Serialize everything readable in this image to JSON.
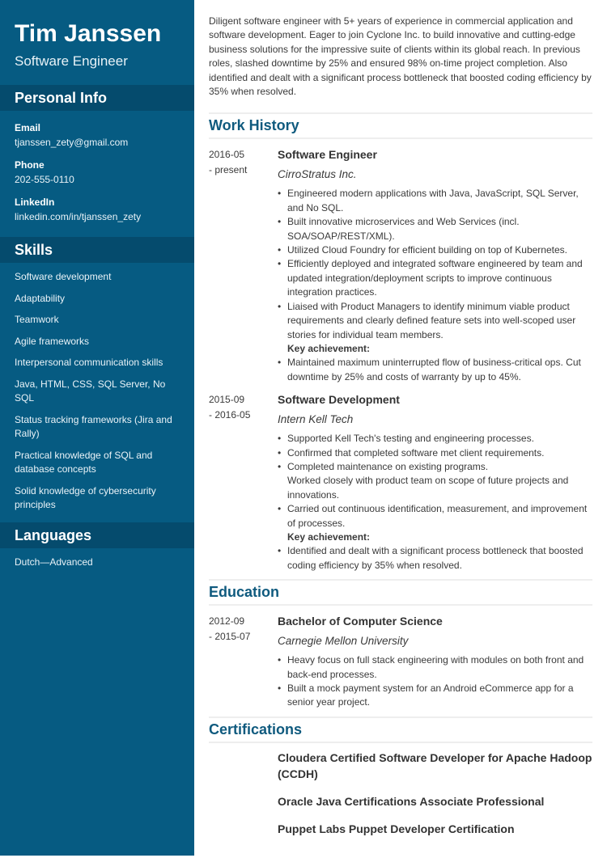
{
  "sidebar": {
    "name": "Tim Janssen",
    "role": "Software Engineer",
    "personal_info": {
      "heading": "Personal Info",
      "fields": [
        {
          "label": "Email",
          "value": "tjanssen_zety@gmail.com"
        },
        {
          "label": "Phone",
          "value": "202-555-0110"
        },
        {
          "label": "LinkedIn",
          "value": "linkedin.com/in/tjanssen_zety"
        }
      ]
    },
    "skills": {
      "heading": "Skills",
      "items": [
        "Software development",
        "Adaptability",
        "Teamwork",
        "Agile frameworks",
        "Interpersonal communication skills",
        "Java, HTML, CSS, SQL Server, No SQL",
        "Status tracking frameworks (Jira and Rally)",
        "Practical knowledge of SQL and database concepts",
        "Solid knowledge of cybersecurity principles"
      ]
    },
    "languages": {
      "heading": "Languages",
      "items": [
        "Dutch—Advanced"
      ]
    }
  },
  "main": {
    "summary": "Diligent software engineer with 5+ years of experience in commercial application and software development. Eager to join Cyclone Inc. to build innovative and cutting-edge business solutions for the impressive suite of clients within its global reach. In previous roles, slashed downtime by 25% and ensured 98% on-time project completion. Also identified and dealt with a significant process bottleneck that boosted coding efficiency by 35% when resolved.",
    "work_history": {
      "heading": "Work History",
      "entries": [
        {
          "date_start": "2016-05",
          "date_end": "- present",
          "title": "Software Engineer",
          "org": "CirroStratus Inc.",
          "bullets": [
            {
              "type": "b",
              "text": "Engineered modern applications with Java, JavaScript, SQL Server, and No SQL."
            },
            {
              "type": "b",
              "text": "Built innovative microservices and Web Services (incl. SOA/SOAP/REST/XML)."
            },
            {
              "type": "b",
              "text": "Utilized Cloud Foundry for efficient building on top of Kubernetes."
            },
            {
              "type": "b",
              "text": "Efficiently deployed and integrated software engineered by team and updated integration/deployment scripts to improve continuous integration practices."
            },
            {
              "type": "b",
              "text": "Liaised with Product Managers to identify minimum viable product requirements and clearly defined feature sets into well-scoped user stories for individual team members."
            },
            {
              "type": "key",
              "text": "Key achievement:"
            },
            {
              "type": "b",
              "text": "Maintained maximum uninterrupted flow of business-critical ops. Cut downtime by 25% and costs of warranty by up to 45%."
            }
          ]
        },
        {
          "date_start": "2015-09",
          "date_end": "- 2016-05",
          "title": "Software Development",
          "org": "Intern Kell Tech",
          "bullets": [
            {
              "type": "b",
              "text": "Supported Kell Tech's testing and engineering processes."
            },
            {
              "type": "b",
              "text": "Confirmed that completed software met client requirements."
            },
            {
              "type": "b",
              "text": "Completed maintenance on existing programs."
            },
            {
              "type": "plain",
              "text": "Worked closely with product team on scope of future projects and innovations."
            },
            {
              "type": "b",
              "text": "Carried out continuous identification, measurement, and improvement of processes."
            },
            {
              "type": "key",
              "text": "Key achievement:"
            },
            {
              "type": "b",
              "text": "Identified and dealt with a significant process bottleneck that boosted coding efficiency by 35% when resolved."
            }
          ]
        }
      ]
    },
    "education": {
      "heading": "Education",
      "entries": [
        {
          "date_start": "2012-09",
          "date_end": "- 2015-07",
          "title": "Bachelor of Computer Science",
          "org": "Carnegie Mellon University",
          "bullets": [
            {
              "type": "b",
              "text": "Heavy focus on full stack engineering with modules on both front and back-end processes."
            },
            {
              "type": "b",
              "text": "Built a mock payment system for an Android eCommerce app for a senior year project."
            }
          ]
        }
      ]
    },
    "certifications": {
      "heading": "Certifications",
      "items": [
        "Cloudera Certified Software Developer for Apache Hadoop (CCDH)",
        "Oracle Java Certifications Associate Professional",
        "Puppet Labs Puppet Developer Certification"
      ]
    }
  }
}
